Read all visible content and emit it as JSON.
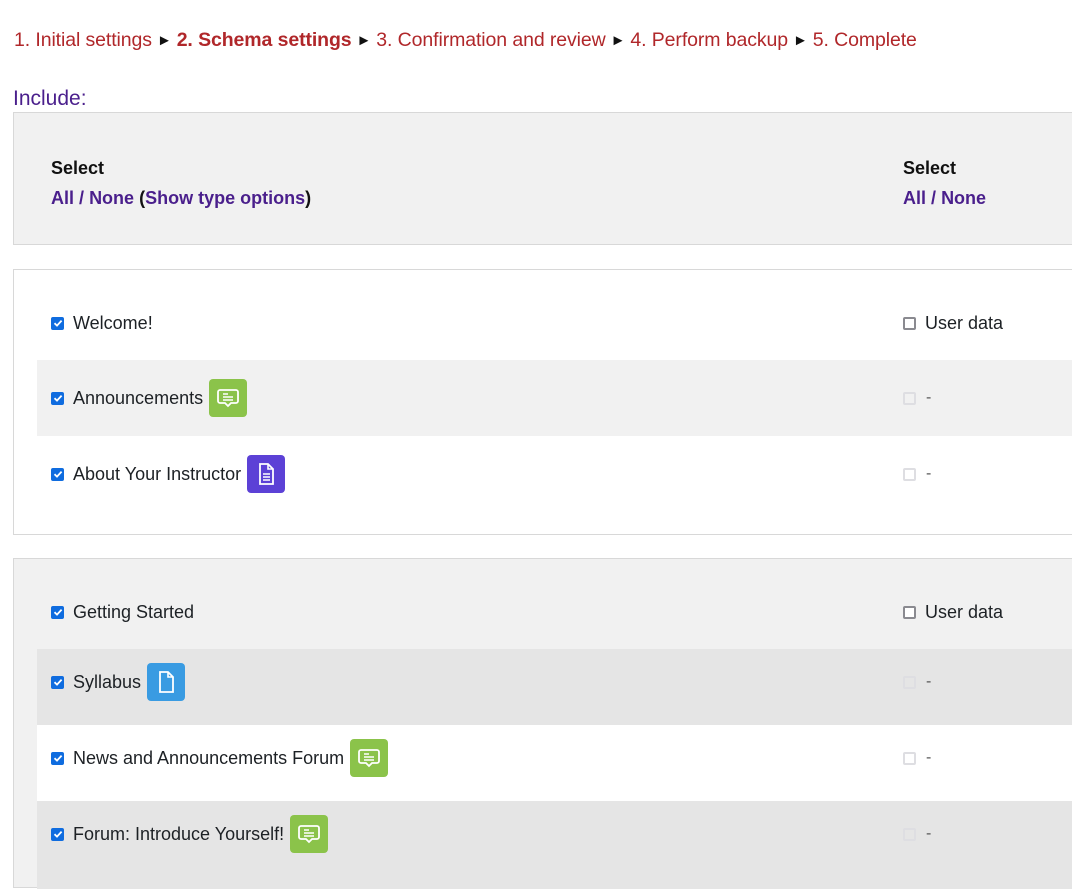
{
  "progress": {
    "steps": [
      {
        "label": "1. Initial settings",
        "current": false
      },
      {
        "label": "2. Schema settings",
        "current": true
      },
      {
        "label": "3. Confirmation and review",
        "current": false
      },
      {
        "label": "4. Perform backup",
        "current": false
      },
      {
        "label": "5. Complete",
        "current": false
      }
    ],
    "separator": "►"
  },
  "include_label": "Include:",
  "select_header": {
    "left": {
      "title": "Select",
      "all": "All",
      "slash": "/",
      "none": "None",
      "open_paren": "(",
      "type_options": "Show type options",
      "close_paren": ")"
    },
    "right": {
      "title": "Select",
      "all": "All",
      "slash": "/",
      "none": "None"
    }
  },
  "sections": [
    {
      "name": "Welcome!",
      "checked": true,
      "user_data_label": "User data",
      "user_data_checked": false,
      "activities": [
        {
          "name": "Announcements",
          "checked": true,
          "icon": "forum-icon",
          "user_data": "-"
        },
        {
          "name": "About Your Instructor",
          "checked": true,
          "icon": "page-icon",
          "user_data": "-"
        }
      ]
    },
    {
      "name": "Getting Started",
      "checked": true,
      "user_data_label": "User data",
      "user_data_checked": false,
      "activities": [
        {
          "name": "Syllabus",
          "checked": true,
          "icon": "file-icon",
          "user_data": "-"
        },
        {
          "name": "News and Announcements Forum",
          "checked": true,
          "icon": "forum-icon",
          "user_data": "-"
        },
        {
          "name": "Forum: Introduce Yourself!",
          "checked": true,
          "icon": "forum-icon",
          "user_data": "-"
        }
      ]
    }
  ],
  "colors": {
    "progress_text": "#b0272a",
    "link": "#4a1f8c",
    "checkbox": "#0f6cdf",
    "forum_icon_bg": "#8bc34a",
    "page_icon_bg": "#5c41d6",
    "file_icon_bg": "#399be2"
  }
}
